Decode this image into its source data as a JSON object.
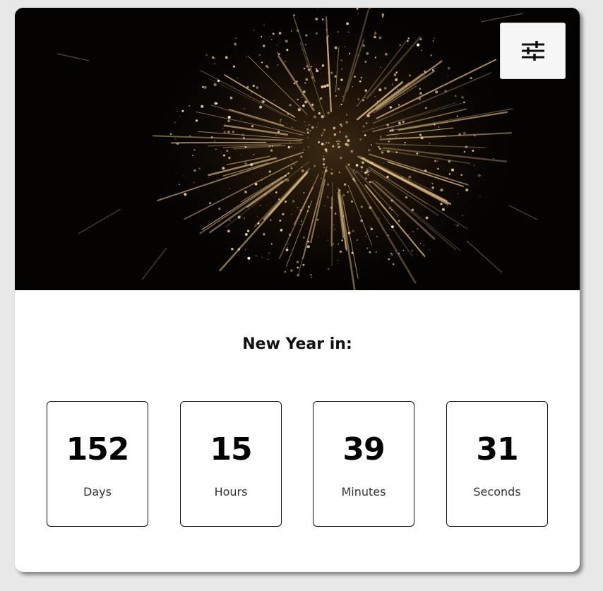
{
  "hero": {
    "image": "fireworks-photo",
    "colors": {
      "background": "#050302",
      "spark": "#e8c48a"
    }
  },
  "settings_button": {
    "icon": "sliders-icon"
  },
  "heading": "New Year in:",
  "countdown": [
    {
      "value": "152",
      "label": "Days"
    },
    {
      "value": "15",
      "label": "Hours"
    },
    {
      "value": "39",
      "label": "Minutes"
    },
    {
      "value": "31",
      "label": "Seconds"
    }
  ]
}
